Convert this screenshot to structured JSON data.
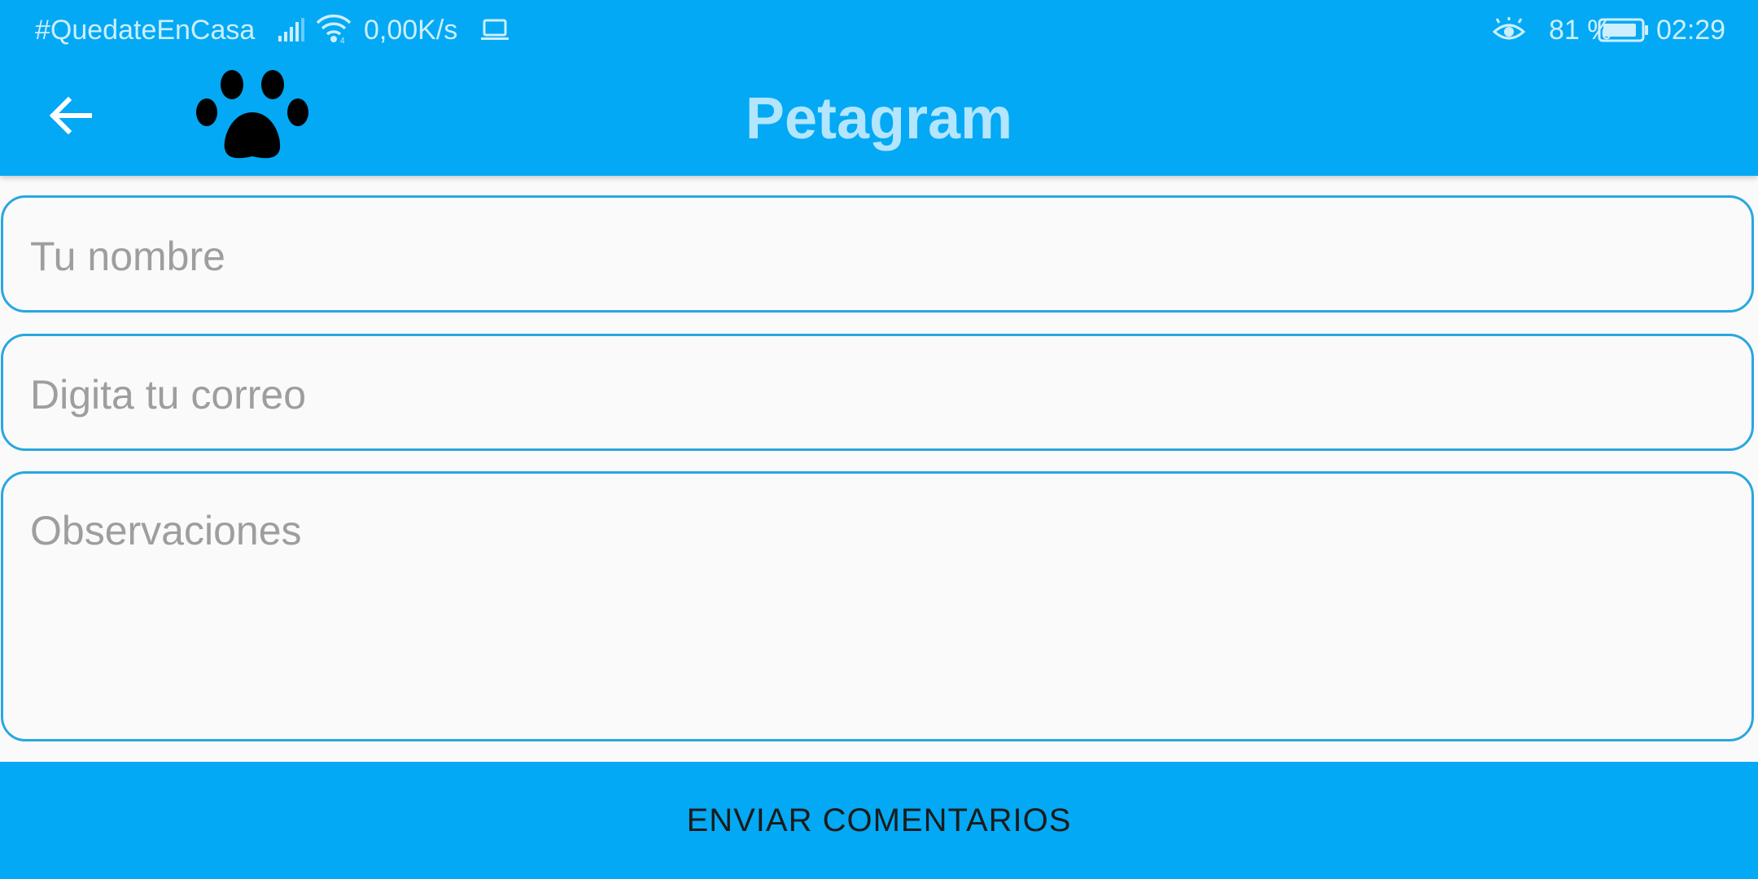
{
  "status_bar": {
    "carrier": "#QuedateEnCasa",
    "net_speed": "0,00K/s",
    "battery_percent": "81 %",
    "time": "02:29",
    "icons": [
      "signal-icon",
      "wifi-icon",
      "laptop-icon",
      "eye-icon",
      "battery-icon"
    ]
  },
  "toolbar": {
    "back_icon": "arrow-back-icon",
    "logo_icon": "paw-icon",
    "title": "Petagram",
    "background": "#03a9f4",
    "title_color": "#b3e5fc"
  },
  "form": {
    "name_placeholder": "Tu nombre",
    "email_placeholder": "Digita tu correo",
    "observations_placeholder": "Observaciones",
    "field_border_color": "#29a7df"
  },
  "send_button": {
    "label": "ENVIAR COMENTARIOS"
  }
}
